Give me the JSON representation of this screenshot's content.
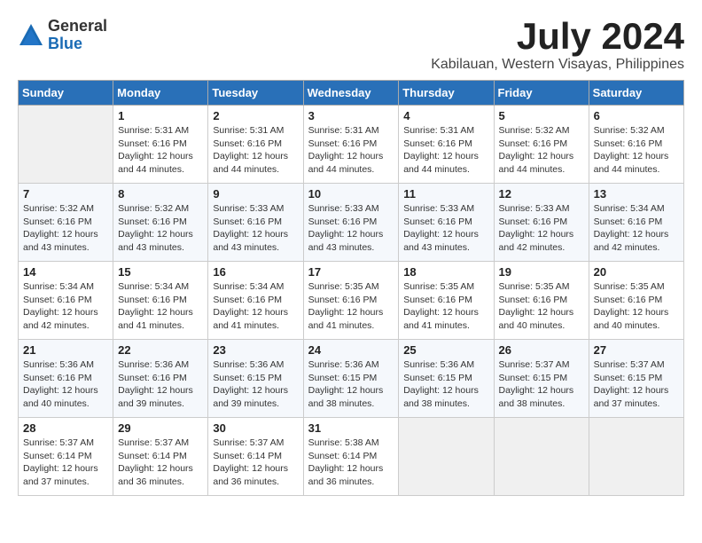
{
  "logo": {
    "general": "General",
    "blue": "Blue"
  },
  "title": {
    "month": "July 2024",
    "location": "Kabilauan, Western Visayas, Philippines"
  },
  "weekdays": [
    "Sunday",
    "Monday",
    "Tuesday",
    "Wednesday",
    "Thursday",
    "Friday",
    "Saturday"
  ],
  "weeks": [
    [
      {
        "day": "",
        "info": ""
      },
      {
        "day": "1",
        "info": "Sunrise: 5:31 AM\nSunset: 6:16 PM\nDaylight: 12 hours\nand 44 minutes."
      },
      {
        "day": "2",
        "info": "Sunrise: 5:31 AM\nSunset: 6:16 PM\nDaylight: 12 hours\nand 44 minutes."
      },
      {
        "day": "3",
        "info": "Sunrise: 5:31 AM\nSunset: 6:16 PM\nDaylight: 12 hours\nand 44 minutes."
      },
      {
        "day": "4",
        "info": "Sunrise: 5:31 AM\nSunset: 6:16 PM\nDaylight: 12 hours\nand 44 minutes."
      },
      {
        "day": "5",
        "info": "Sunrise: 5:32 AM\nSunset: 6:16 PM\nDaylight: 12 hours\nand 44 minutes."
      },
      {
        "day": "6",
        "info": "Sunrise: 5:32 AM\nSunset: 6:16 PM\nDaylight: 12 hours\nand 44 minutes."
      }
    ],
    [
      {
        "day": "7",
        "info": "Sunrise: 5:32 AM\nSunset: 6:16 PM\nDaylight: 12 hours\nand 43 minutes."
      },
      {
        "day": "8",
        "info": "Sunrise: 5:32 AM\nSunset: 6:16 PM\nDaylight: 12 hours\nand 43 minutes."
      },
      {
        "day": "9",
        "info": "Sunrise: 5:33 AM\nSunset: 6:16 PM\nDaylight: 12 hours\nand 43 minutes."
      },
      {
        "day": "10",
        "info": "Sunrise: 5:33 AM\nSunset: 6:16 PM\nDaylight: 12 hours\nand 43 minutes."
      },
      {
        "day": "11",
        "info": "Sunrise: 5:33 AM\nSunset: 6:16 PM\nDaylight: 12 hours\nand 43 minutes."
      },
      {
        "day": "12",
        "info": "Sunrise: 5:33 AM\nSunset: 6:16 PM\nDaylight: 12 hours\nand 42 minutes."
      },
      {
        "day": "13",
        "info": "Sunrise: 5:34 AM\nSunset: 6:16 PM\nDaylight: 12 hours\nand 42 minutes."
      }
    ],
    [
      {
        "day": "14",
        "info": "Sunrise: 5:34 AM\nSunset: 6:16 PM\nDaylight: 12 hours\nand 42 minutes."
      },
      {
        "day": "15",
        "info": "Sunrise: 5:34 AM\nSunset: 6:16 PM\nDaylight: 12 hours\nand 41 minutes."
      },
      {
        "day": "16",
        "info": "Sunrise: 5:34 AM\nSunset: 6:16 PM\nDaylight: 12 hours\nand 41 minutes."
      },
      {
        "day": "17",
        "info": "Sunrise: 5:35 AM\nSunset: 6:16 PM\nDaylight: 12 hours\nand 41 minutes."
      },
      {
        "day": "18",
        "info": "Sunrise: 5:35 AM\nSunset: 6:16 PM\nDaylight: 12 hours\nand 41 minutes."
      },
      {
        "day": "19",
        "info": "Sunrise: 5:35 AM\nSunset: 6:16 PM\nDaylight: 12 hours\nand 40 minutes."
      },
      {
        "day": "20",
        "info": "Sunrise: 5:35 AM\nSunset: 6:16 PM\nDaylight: 12 hours\nand 40 minutes."
      }
    ],
    [
      {
        "day": "21",
        "info": "Sunrise: 5:36 AM\nSunset: 6:16 PM\nDaylight: 12 hours\nand 40 minutes."
      },
      {
        "day": "22",
        "info": "Sunrise: 5:36 AM\nSunset: 6:16 PM\nDaylight: 12 hours\nand 39 minutes."
      },
      {
        "day": "23",
        "info": "Sunrise: 5:36 AM\nSunset: 6:15 PM\nDaylight: 12 hours\nand 39 minutes."
      },
      {
        "day": "24",
        "info": "Sunrise: 5:36 AM\nSunset: 6:15 PM\nDaylight: 12 hours\nand 38 minutes."
      },
      {
        "day": "25",
        "info": "Sunrise: 5:36 AM\nSunset: 6:15 PM\nDaylight: 12 hours\nand 38 minutes."
      },
      {
        "day": "26",
        "info": "Sunrise: 5:37 AM\nSunset: 6:15 PM\nDaylight: 12 hours\nand 38 minutes."
      },
      {
        "day": "27",
        "info": "Sunrise: 5:37 AM\nSunset: 6:15 PM\nDaylight: 12 hours\nand 37 minutes."
      }
    ],
    [
      {
        "day": "28",
        "info": "Sunrise: 5:37 AM\nSunset: 6:14 PM\nDaylight: 12 hours\nand 37 minutes."
      },
      {
        "day": "29",
        "info": "Sunrise: 5:37 AM\nSunset: 6:14 PM\nDaylight: 12 hours\nand 36 minutes."
      },
      {
        "day": "30",
        "info": "Sunrise: 5:37 AM\nSunset: 6:14 PM\nDaylight: 12 hours\nand 36 minutes."
      },
      {
        "day": "31",
        "info": "Sunrise: 5:38 AM\nSunset: 6:14 PM\nDaylight: 12 hours\nand 36 minutes."
      },
      {
        "day": "",
        "info": ""
      },
      {
        "day": "",
        "info": ""
      },
      {
        "day": "",
        "info": ""
      }
    ]
  ]
}
